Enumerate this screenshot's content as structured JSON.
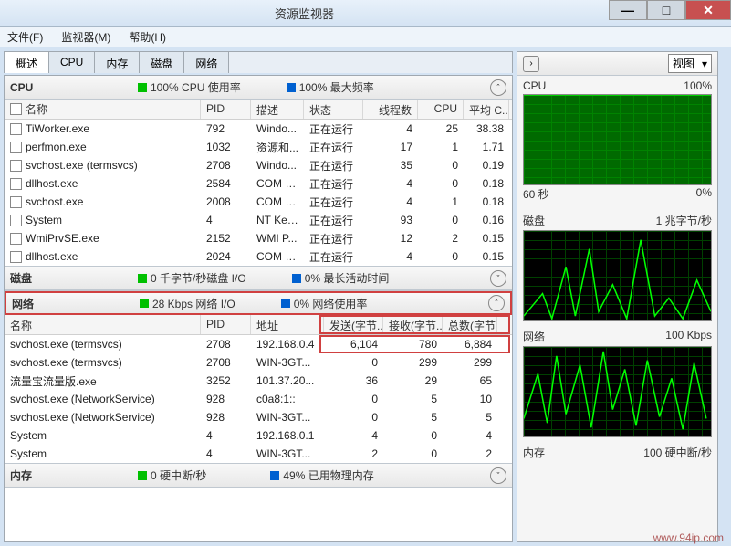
{
  "window": {
    "title": "资源监视器",
    "min": "—",
    "max": "□",
    "close": "✕"
  },
  "menu": {
    "file": "文件(F)",
    "monitor": "监视器(M)",
    "help": "帮助(H)"
  },
  "tabs": {
    "overview": "概述",
    "cpu": "CPU",
    "memory": "内存",
    "disk": "磁盘",
    "network": "网络"
  },
  "cpu_section": {
    "name": "CPU",
    "legend1": "100% CPU 使用率",
    "legend2": "100% 最大频率",
    "cols": {
      "name": "名称",
      "pid": "PID",
      "desc": "描述",
      "stat": "状态",
      "thr": "线程数",
      "cpu": "CPU",
      "avg": "平均 C..."
    },
    "rows": [
      {
        "name": "TiWorker.exe",
        "pid": "792",
        "desc": "Windo...",
        "stat": "正在运行",
        "thr": "4",
        "cpu": "25",
        "avg": "38.38"
      },
      {
        "name": "perfmon.exe",
        "pid": "1032",
        "desc": "资源和...",
        "stat": "正在运行",
        "thr": "17",
        "cpu": "1",
        "avg": "1.71"
      },
      {
        "name": "svchost.exe (termsvcs)",
        "pid": "2708",
        "desc": "Windo...",
        "stat": "正在运行",
        "thr": "35",
        "cpu": "0",
        "avg": "0.19"
      },
      {
        "name": "dllhost.exe",
        "pid": "2584",
        "desc": "COM S...",
        "stat": "正在运行",
        "thr": "4",
        "cpu": "0",
        "avg": "0.18"
      },
      {
        "name": "svchost.exe",
        "pid": "2008",
        "desc": "COM S...",
        "stat": "正在运行",
        "thr": "4",
        "cpu": "1",
        "avg": "0.18"
      },
      {
        "name": "System",
        "pid": "4",
        "desc": "NT Ker...",
        "stat": "正在运行",
        "thr": "93",
        "cpu": "0",
        "avg": "0.16"
      },
      {
        "name": "WmiPrvSE.exe",
        "pid": "2152",
        "desc": "WMI P...",
        "stat": "正在运行",
        "thr": "12",
        "cpu": "2",
        "avg": "0.15"
      },
      {
        "name": "dllhost.exe",
        "pid": "2024",
        "desc": "COM S...",
        "stat": "正在运行",
        "thr": "4",
        "cpu": "0",
        "avg": "0.15"
      }
    ]
  },
  "disk_section": {
    "name": "磁盘",
    "legend1": "0 千字节/秒磁盘 I/O",
    "legend2": "0% 最长活动时间"
  },
  "net_section": {
    "name": "网络",
    "legend1": "28 Kbps 网络 I/O",
    "legend2": "0% 网络使用率",
    "cols": {
      "name": "名称",
      "pid": "PID",
      "addr": "地址",
      "send": "发送(字节...",
      "recv": "接收(字节...",
      "tot": "总数(字节..."
    },
    "rows": [
      {
        "name": "svchost.exe (termsvcs)",
        "pid": "2708",
        "addr": "192.168.0.4",
        "send": "6,104",
        "recv": "780",
        "tot": "6,884"
      },
      {
        "name": "svchost.exe (termsvcs)",
        "pid": "2708",
        "addr": "WIN-3GT...",
        "send": "0",
        "recv": "299",
        "tot": "299"
      },
      {
        "name": "流量宝流量版.exe",
        "pid": "3252",
        "addr": "101.37.20...",
        "send": "36",
        "recv": "29",
        "tot": "65"
      },
      {
        "name": "svchost.exe (NetworkService)",
        "pid": "928",
        "addr": "c0a8:1::",
        "send": "0",
        "recv": "5",
        "tot": "10"
      },
      {
        "name": "svchost.exe (NetworkService)",
        "pid": "928",
        "addr": "WIN-3GT...",
        "send": "0",
        "recv": "5",
        "tot": "5"
      },
      {
        "name": "System",
        "pid": "4",
        "addr": "192.168.0.1",
        "send": "4",
        "recv": "0",
        "tot": "4"
      },
      {
        "name": "System",
        "pid": "4",
        "addr": "WIN-3GT...",
        "send": "2",
        "recv": "0",
        "tot": "2"
      }
    ]
  },
  "mem_section": {
    "name": "内存",
    "legend1": "0 硬中断/秒",
    "legend2": "49% 已用物理内存"
  },
  "charts": {
    "view": "视图",
    "cpu": {
      "label": "CPU",
      "right": "100%",
      "bottom_left": "60 秒",
      "bottom_right": "0%"
    },
    "disk": {
      "label": "磁盘",
      "right": "1 兆字节/秒"
    },
    "net": {
      "label": "网络",
      "right": "100 Kbps"
    },
    "mem": {
      "label": "内存",
      "right": "100 硬中断/秒"
    }
  },
  "chart_data": {
    "cpu_usage_pct": 100,
    "cpu_max_freq_pct": 100,
    "disk_io_kbps": 0,
    "disk_active_pct": 0,
    "net_io_kbps": 28,
    "net_usage_pct": 0,
    "mem_hard_faults_per_s": 0,
    "mem_used_pct": 49,
    "time_window_s": 60
  },
  "watermark": "www.94ip.com"
}
